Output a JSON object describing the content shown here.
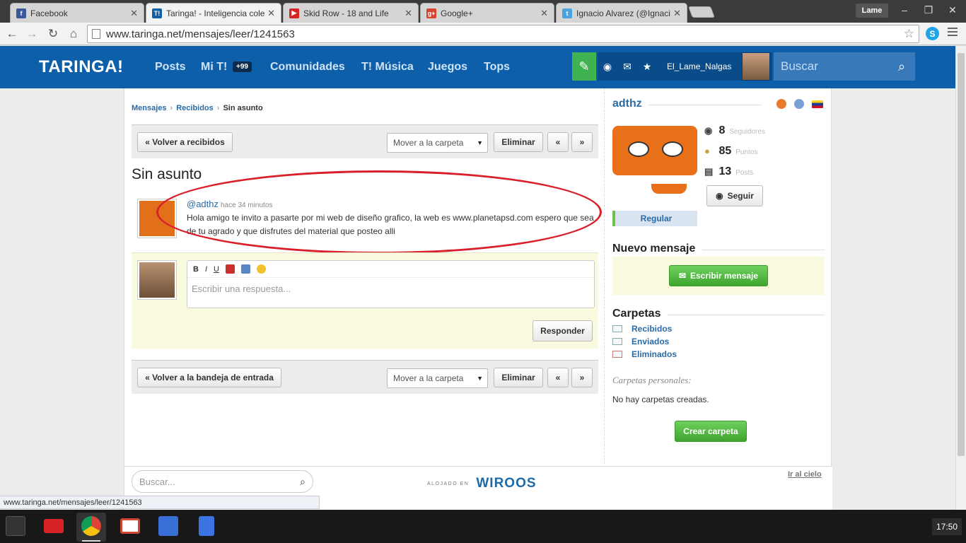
{
  "browser": {
    "tabs": [
      {
        "title": "Facebook",
        "favicon": "facebook-icon",
        "color": "#3b5998",
        "glyph": "f"
      },
      {
        "title": "Taringa! - Inteligencia colectiva",
        "favicon": "taringa-icon",
        "color": "#0c5fa8",
        "glyph": "T!"
      },
      {
        "title": "Skid Row - 18 and Life",
        "favicon": "youtube-icon",
        "color": "#d62222",
        "glyph": "▶"
      },
      {
        "title": "Google+",
        "favicon": "google-plus-icon",
        "color": "#d9422e",
        "glyph": "g+"
      },
      {
        "title": "Ignacio Alvarez (@Ignacio",
        "favicon": "twitter-icon",
        "color": "#4aa3df",
        "glyph": "t"
      }
    ],
    "user_chip": "Lame",
    "url": "www.taringa.net/mensajes/leer/1241563",
    "status_url": "www.taringa.net/mensajes/leer/1241563"
  },
  "site": {
    "logo": "TARINGA!",
    "nav": {
      "posts": "Posts",
      "mi_t": "Mi T!",
      "mi_t_badge": "+99",
      "comunidades": "Comunidades",
      "musica": "T! Música",
      "juegos": "Juegos",
      "tops": "Tops"
    },
    "username": "El_Lame_Nalgas",
    "search_placeholder": "Buscar",
    "accent": "#0c5fa8"
  },
  "breadcrumb": {
    "mensajes": "Mensajes",
    "recibidos": "Recibidos",
    "current": "Sin asunto"
  },
  "actions": {
    "back_received": "« Volver a recibidos",
    "back_inbox": "« Volver a la bandeja de entrada",
    "move_folder": "Mover a la carpeta",
    "delete": "Eliminar",
    "prev": "«",
    "next": "»"
  },
  "message": {
    "subject": "Sin asunto",
    "sender": "@adthz",
    "time": "hace 34 minutos",
    "body": "Hola amigo te invito a pasarte por mi web de diseño grafico, la web es www.planetapsd.com espero que sea de tu agrado y que disfrutes del material que posteo alli"
  },
  "reply": {
    "placeholder": "Escribir una respuesta...",
    "bold": "B",
    "italic": "I",
    "underline": "U",
    "submit": "Responder"
  },
  "sidebar": {
    "username": "adthz",
    "followers": "8",
    "followers_label": "Seguidores",
    "points": "85",
    "points_label": "Puntos",
    "posts": "13",
    "posts_label": "Posts",
    "follow": "Seguir",
    "rank": "Regular",
    "new_message_title": "Nuevo mensaje",
    "write_message": "Escribir mensaje",
    "folders_title": "Carpetas",
    "folders": [
      "Recibidos",
      "Enviados",
      "Eliminados"
    ],
    "personal_title": "Carpetas personales:",
    "no_folders": "No hay carpetas creadas.",
    "create_folder": "Crear carpeta"
  },
  "footer": {
    "search_placeholder": "Buscar...",
    "hosted_label": "ALOJADO EN",
    "hosted_brand": "WIROOS",
    "go_top": "Ir al cielo"
  },
  "taskbar": {
    "clock": "17:50",
    "apps": [
      "apps-grid-icon",
      "youtube-icon",
      "chrome-icon",
      "gmail-icon",
      "google-search-icon",
      "docs-icon"
    ]
  }
}
